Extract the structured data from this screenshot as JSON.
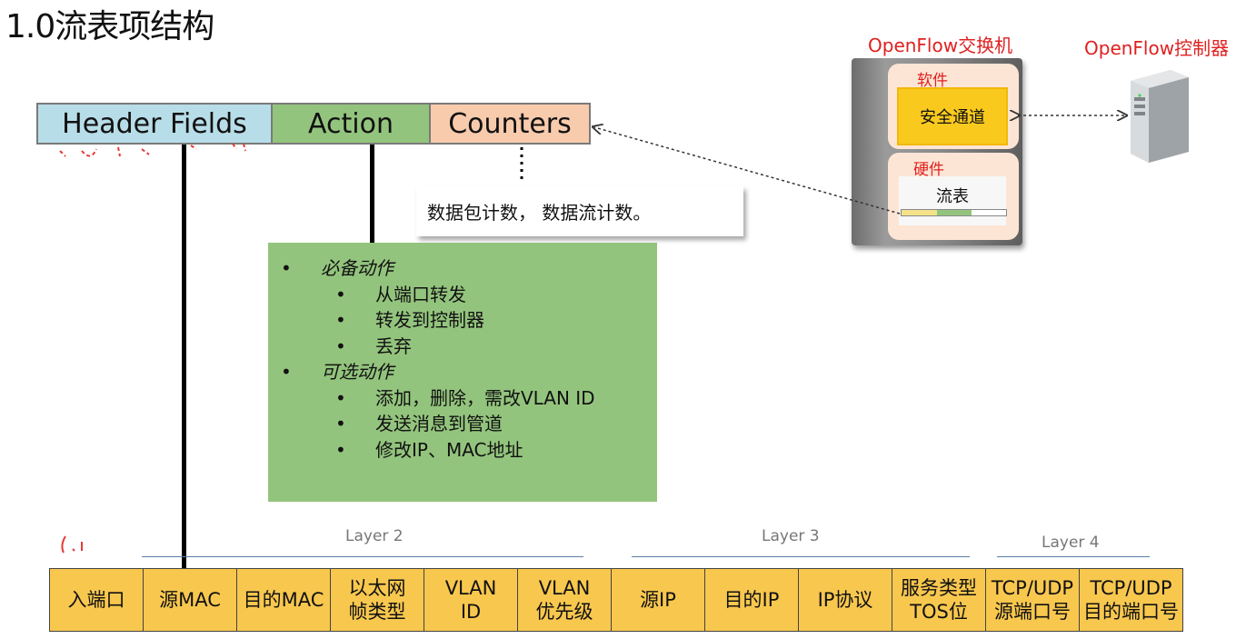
{
  "title": "1.0流表项结构",
  "flow_entry": {
    "header_fields": "Header Fields",
    "action": "Action",
    "counters": "Counters"
  },
  "counters_desc": "数据包计数， 数据流计数。",
  "actions": {
    "required_title": "必备动作",
    "required_items": [
      "从端口转发",
      "转发到控制器",
      "丢弃"
    ],
    "optional_title": "可选动作",
    "optional_items": [
      "添加，删除，需改VLAN ID",
      "发送消息到管道",
      "修改IP、MAC地址"
    ],
    "bullet": "•"
  },
  "layers": {
    "layer2": "Layer 2",
    "layer3": "Layer 3",
    "layer4": "Layer 4"
  },
  "fields": [
    [
      "入端口"
    ],
    [
      "源MAC"
    ],
    [
      "目的MAC"
    ],
    [
      "以太网",
      "帧类型"
    ],
    [
      "VLAN",
      "ID"
    ],
    [
      "VLAN",
      "优先级"
    ],
    [
      "源IP"
    ],
    [
      "目的IP"
    ],
    [
      "IP协议"
    ],
    [
      "服务类型",
      "TOS位"
    ],
    [
      "TCP/UDP",
      "源端口号"
    ],
    [
      "TCP/UDP",
      "目的端口号"
    ]
  ],
  "switch": {
    "label": "OpenFlow交换机",
    "software": "软件",
    "secure_channel": "安全通道",
    "hardware": "硬件",
    "flow_table": "流表"
  },
  "controller": {
    "label": "OpenFlow控制器"
  },
  "colors": {
    "header": "#b7dde8",
    "action": "#93c47d",
    "counters": "#f8cbad",
    "field": "#f8c74e",
    "red_label": "#e02020"
  }
}
